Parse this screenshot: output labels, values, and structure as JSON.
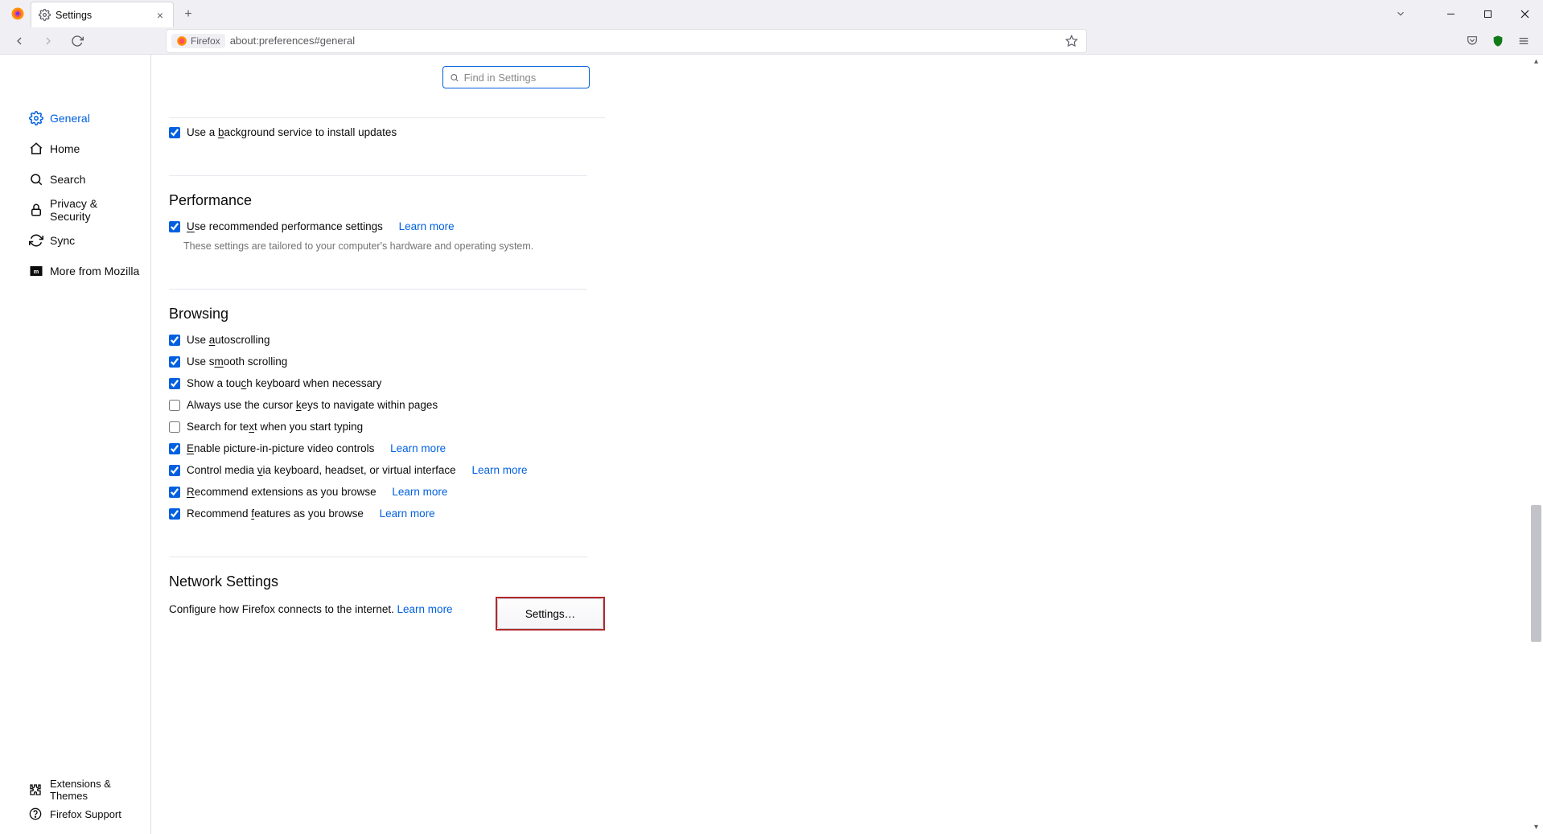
{
  "tab": {
    "title": "Settings"
  },
  "url": {
    "identity_label": "Firefox",
    "text": "about:preferences#general"
  },
  "search": {
    "placeholder": "Find in Settings"
  },
  "sidebar": {
    "items": [
      {
        "label": "General"
      },
      {
        "label": "Home"
      },
      {
        "label": "Search"
      },
      {
        "label": "Privacy & Security"
      },
      {
        "label": "Sync"
      },
      {
        "label": "More from Mozilla"
      }
    ],
    "bottom": [
      {
        "label": "Extensions & Themes"
      },
      {
        "label": "Firefox Support"
      }
    ]
  },
  "updates": {
    "bg_service_label": "Use a background service to install updates"
  },
  "performance": {
    "heading": "Performance",
    "recommended_label": "Use recommended performance settings",
    "learn_more": "Learn more",
    "hint": "These settings are tailored to your computer's hardware and operating system."
  },
  "browsing": {
    "heading": "Browsing",
    "autoscroll": "Use autoscrolling",
    "smooth": "Use smooth scrolling",
    "touch_kb": "Show a touch keyboard when necessary",
    "cursor_keys": "Always use the cursor keys to navigate within pages",
    "search_typing": "Search for text when you start typing",
    "pip": "Enable picture-in-picture video controls",
    "pip_learn": "Learn more",
    "media_ctrl": "Control media via keyboard, headset, or virtual interface",
    "media_learn": "Learn more",
    "rec_ext": "Recommend extensions as you browse",
    "rec_ext_learn": "Learn more",
    "rec_feat": "Recommend features as you browse",
    "rec_feat_learn": "Learn more"
  },
  "network": {
    "heading": "Network Settings",
    "desc": "Configure how Firefox connects to the internet.",
    "learn": "Learn more",
    "button": "Settings…"
  }
}
